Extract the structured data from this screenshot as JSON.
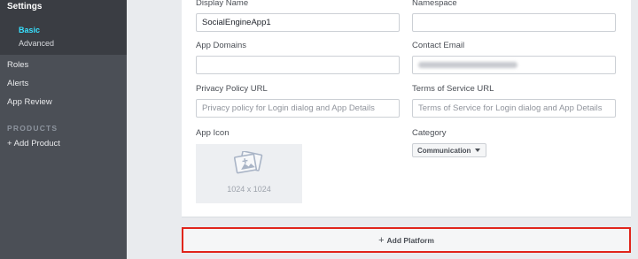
{
  "sidebar": {
    "settings_title": "Settings",
    "settings_sub": [
      "Basic",
      "Advanced"
    ],
    "nav_items": [
      "Roles",
      "Alerts",
      "App Review"
    ],
    "section_title": "PRODUCTS",
    "add_product": "+ Add Product"
  },
  "form": {
    "display_name": {
      "label": "Display Name",
      "value": "SocialEngineApp1"
    },
    "namespace": {
      "label": "Namespace",
      "value": ""
    },
    "app_domains": {
      "label": "App Domains",
      "value": ""
    },
    "contact_email": {
      "label": "Contact Email"
    },
    "privacy_policy": {
      "label": "Privacy Policy URL",
      "placeholder": "Privacy policy for Login dialog and App Details"
    },
    "terms_of_service": {
      "label": "Terms of Service URL",
      "placeholder": "Terms of Service for Login dialog and App Details"
    },
    "app_icon": {
      "label": "App Icon",
      "size": "1024 x 1024"
    },
    "category": {
      "label": "Category",
      "value": "Communication"
    }
  },
  "add_platform": {
    "plus": "+",
    "label": "Add Platform"
  },
  "colors": {
    "accent": "#38e1ff",
    "highlight_border": "#e0251b",
    "sidebar": "#4b4f56"
  }
}
